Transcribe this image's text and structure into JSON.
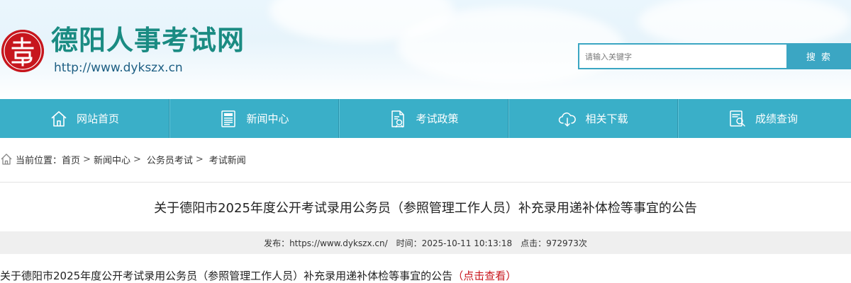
{
  "header": {
    "site_title": "德阳人事考试网",
    "site_url": "http://www.dykszx.cn",
    "logo_icon": "seal-logo-icon"
  },
  "search": {
    "placeholder": "请输入关键字",
    "button_label": "搜 索"
  },
  "nav": {
    "items": [
      {
        "label": "网站首页",
        "icon": "home-icon"
      },
      {
        "label": "新闻中心",
        "icon": "news-icon"
      },
      {
        "label": "考试政策",
        "icon": "policy-document-icon"
      },
      {
        "label": "相关下载",
        "icon": "cloud-download-icon"
      },
      {
        "label": "成绩查询",
        "icon": "score-search-icon"
      }
    ]
  },
  "breadcrumb": {
    "prefix": "当前位置：",
    "items": [
      "首页",
      "新闻中心",
      "公务员考试",
      "考试新闻"
    ],
    "separator": ">"
  },
  "article": {
    "title": "关于德阳市2025年度公开考试录用公务员（参照管理工作人员）补充录用递补体检等事宜的公告",
    "meta": {
      "source": "发布：https://www.dykszx.cn/",
      "time": "时间：2025-10-11 10:13:18",
      "clicks": "点击：972973次"
    },
    "body_text": "关于德阳市2025年度公开考试录用公务员（参照管理工作人员）补充录用递补体检等事宜的公告",
    "body_link": "（点击查看）"
  },
  "colors": {
    "nav_bg": "#3aafc8",
    "title_green": "#1a8b82",
    "seal_red": "#c7161d",
    "link_red": "#c8161d"
  }
}
